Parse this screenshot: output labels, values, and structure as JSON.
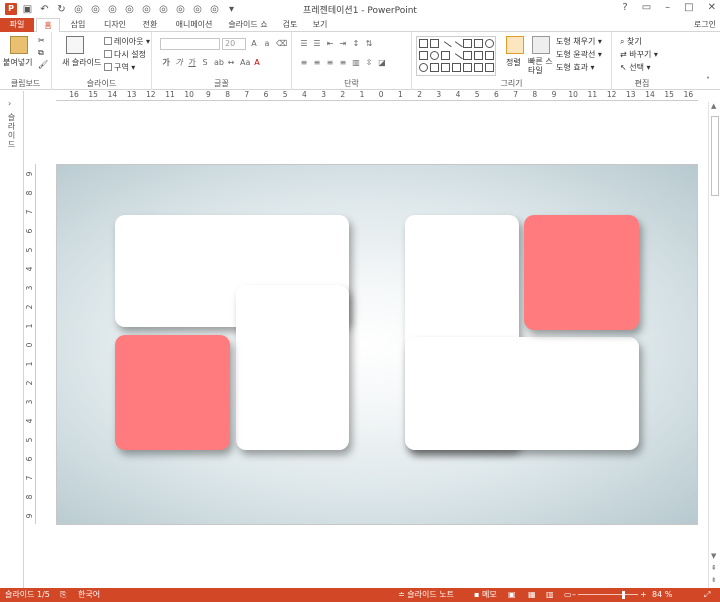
{
  "app": {
    "title": "프레젠테이션1 - PowerPoint",
    "icon_letter": "P",
    "sign_in": "로그인"
  },
  "qat": [
    "save-icon",
    "undo-icon",
    "redo-icon"
  ],
  "tabs": [
    {
      "label": "파일"
    },
    {
      "label": "홈"
    },
    {
      "label": "삽입"
    },
    {
      "label": "디자인"
    },
    {
      "label": "전환"
    },
    {
      "label": "애니메이션"
    },
    {
      "label": "슬라이드 쇼"
    },
    {
      "label": "검토"
    },
    {
      "label": "보기"
    }
  ],
  "ribbon": {
    "clipboard": {
      "paste": "붙여넣기",
      "label": "클립보드"
    },
    "slides": {
      "new_slide": "새 슬라이드",
      "layout": "레이아웃 ▾",
      "reset": "다시 설정",
      "section": "구역 ▾",
      "label": "슬라이드"
    },
    "font": {
      "size": "20",
      "label": "글꼴"
    },
    "paragraph": {
      "label": "단락"
    },
    "drawing": {
      "arrange": "정렬",
      "quick_styles": "빠른 스타일",
      "fill": "도형 채우기 ▾",
      "outline": "도형 윤곽선 ▾",
      "effects": "도형 효과 ▾",
      "label": "그리기"
    },
    "editing": {
      "find": "찾기",
      "replace": "바꾸기 ▾",
      "select": "선택 ▾",
      "label": "편집"
    }
  },
  "left_pane": {
    "vertical_text": "슬라이드"
  },
  "hruler": [
    "16",
    "15",
    "14",
    "13",
    "12",
    "11",
    "10",
    "9",
    "8",
    "7",
    "6",
    "5",
    "4",
    "3",
    "2",
    "1",
    "0",
    "1",
    "2",
    "3",
    "4",
    "5",
    "6",
    "7",
    "8",
    "9",
    "10",
    "11",
    "12",
    "13",
    "14",
    "15",
    "16"
  ],
  "vruler": [
    "9",
    "8",
    "7",
    "6",
    "5",
    "4",
    "3",
    "2",
    "1",
    "0",
    "1",
    "2",
    "3",
    "4",
    "5",
    "6",
    "7",
    "8",
    "9"
  ],
  "status": {
    "slide": "슬라이드 1/5",
    "language": "한국어",
    "notes": "슬라이드 노트",
    "comments": "메모",
    "zoom": "84 %"
  },
  "colors": {
    "accent": "#d24726",
    "pink": "#ff7b7e",
    "white": "#ffffff"
  }
}
